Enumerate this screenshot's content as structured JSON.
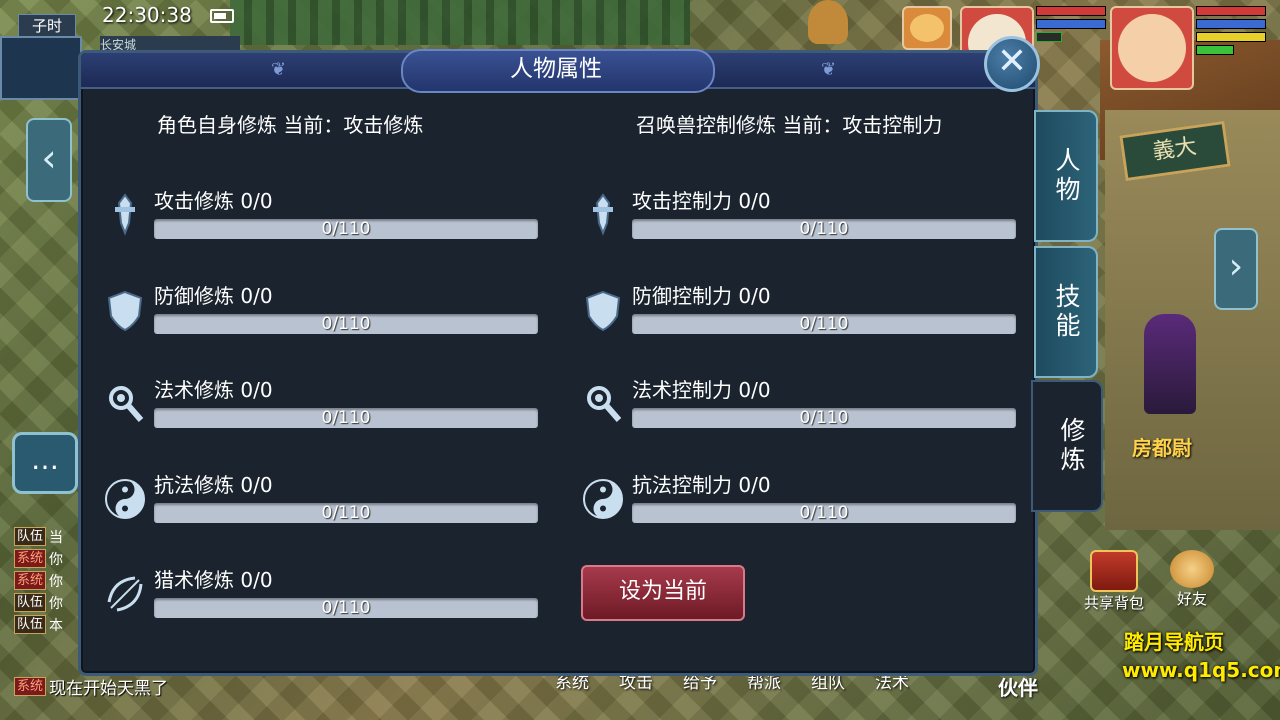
{
  "hud": {
    "shichen": "子时",
    "time": "22:30:38",
    "city": "长安城"
  },
  "scene": {
    "npc_name": "房都尉",
    "sign": "義大"
  },
  "watermark": {
    "line1": "踏月导航页",
    "line2": "www.q1q5.com"
  },
  "bottom_menu": [
    "系统",
    "攻击",
    "给予",
    "帮派",
    "组队",
    "法术"
  ],
  "partner_label": "伙伴",
  "shortcuts": {
    "share_bag": "共享背包",
    "friends": "好友"
  },
  "chat": {
    "lines": [
      {
        "tag": "队伍",
        "tail": "当",
        "type": "team"
      },
      {
        "tag": "系统",
        "tail": "你",
        "type": "sys"
      },
      {
        "tag": "系统",
        "tail": "你",
        "type": "sys"
      },
      {
        "tag": "队伍",
        "tail": "你",
        "type": "team"
      },
      {
        "tag": "队伍",
        "tail": "本",
        "type": "team"
      }
    ],
    "last": {
      "tag": "系统",
      "tail": "现在开始天黑了"
    }
  },
  "panel": {
    "title": "人物属性",
    "left_header": "角色自身修炼  当前：攻击修炼",
    "right_header": "召唤兽控制修炼  当前：攻击控制力",
    "set_current_button": "设为当前",
    "left_rows": [
      {
        "label": "攻击修炼 0/0",
        "progress": "0/110",
        "fill": 0,
        "icon": "sword-icon"
      },
      {
        "label": "防御修炼 0/0",
        "progress": "0/110",
        "fill": 0,
        "icon": "shield-icon"
      },
      {
        "label": "法术修炼 0/0",
        "progress": "0/110",
        "fill": 0,
        "icon": "magic-staff-icon"
      },
      {
        "label": "抗法修炼 0/0",
        "progress": "0/110",
        "fill": 0,
        "icon": "yin-yang-icon"
      },
      {
        "label": "猎术修炼 0/0",
        "progress": "0/110",
        "fill": 0,
        "icon": "bow-icon"
      }
    ],
    "right_rows": [
      {
        "label": "攻击控制力 0/0",
        "progress": "0/110",
        "fill": 0,
        "icon": "sword-icon"
      },
      {
        "label": "防御控制力 0/0",
        "progress": "0/110",
        "fill": 0,
        "icon": "shield-icon"
      },
      {
        "label": "法术控制力 0/0",
        "progress": "0/110",
        "fill": 0,
        "icon": "magic-staff-icon"
      },
      {
        "label": "抗法控制力 0/0",
        "progress": "0/110",
        "fill": 0,
        "icon": "yin-yang-icon"
      }
    ],
    "tabs": [
      {
        "label": "人物",
        "active": false
      },
      {
        "label": "技能",
        "active": false
      },
      {
        "label": "修炼",
        "active": true
      }
    ]
  }
}
